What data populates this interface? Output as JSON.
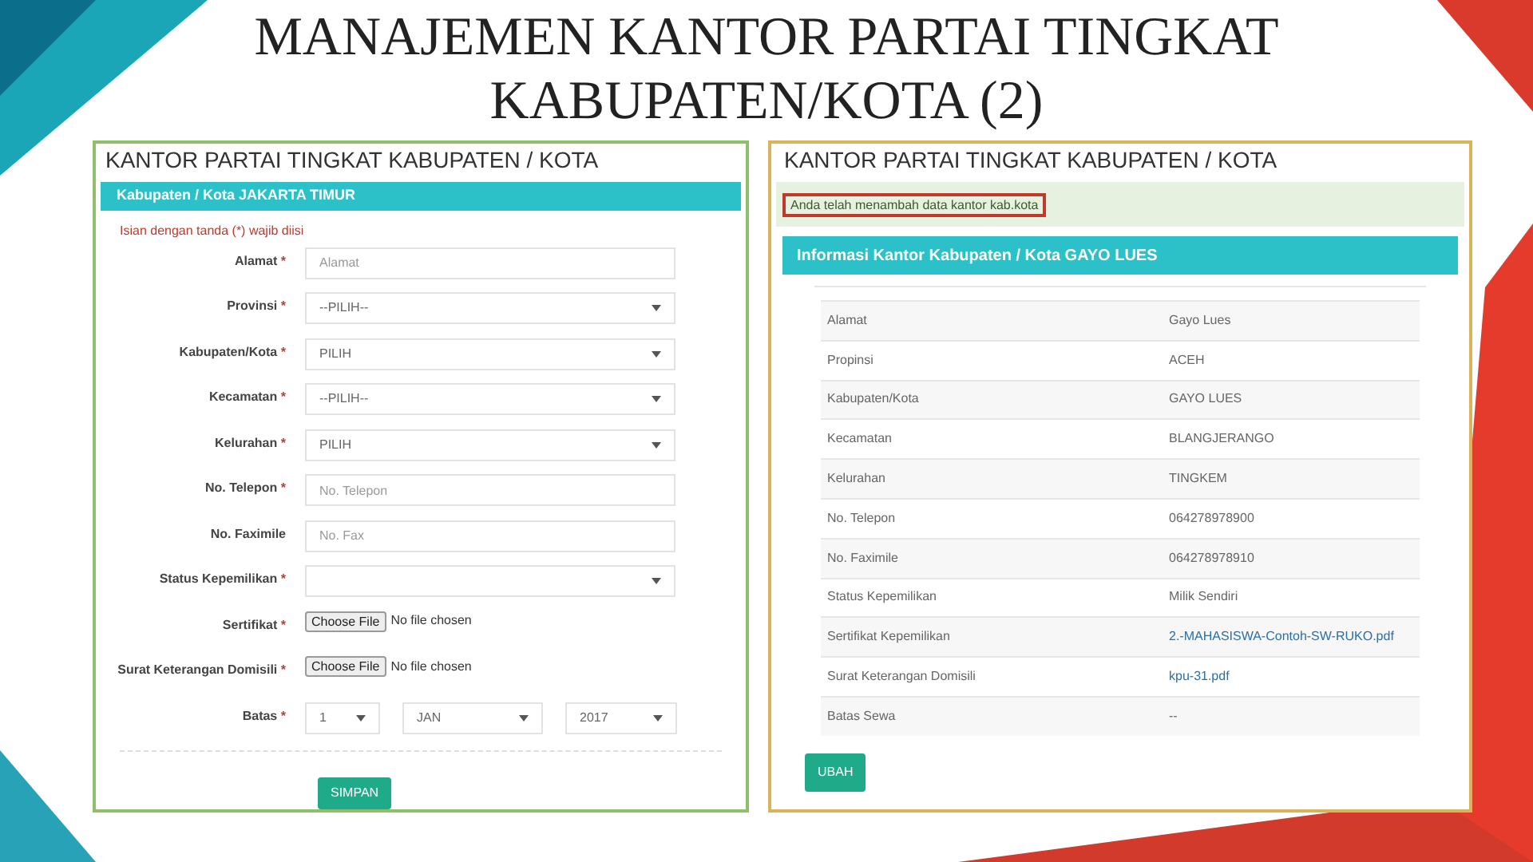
{
  "slide_title": "MANAJEMEN KANTOR PARTAI TINGKAT KABUPATEN/KOTA (2)",
  "form_panel": {
    "title": "KANTOR PARTAI TINGKAT KABUPATEN / KOTA",
    "header": "Kabupaten / Kota JAKARTA TIMUR",
    "note": "Isian dengan tanda (*) wajib diisi",
    "fields": [
      {
        "label": "Alamat",
        "mark": "*",
        "kind": "input",
        "placeholder": "Alamat"
      },
      {
        "label": "Provinsi",
        "mark": "*",
        "kind": "select",
        "value": "--PILIH--"
      },
      {
        "label": "Kabupaten/Kota",
        "mark": "*",
        "kind": "select",
        "value": "PILIH"
      },
      {
        "label": "Kecamatan",
        "mark": "*",
        "kind": "select",
        "value": "--PILIH--"
      },
      {
        "label": "Kelurahan",
        "mark": "*",
        "kind": "select",
        "value": "PILIH"
      },
      {
        "label": "No. Telepon",
        "mark": "*",
        "kind": "input",
        "placeholder": "No. Telepon"
      },
      {
        "label": "No. Faximile",
        "kind": "input",
        "placeholder": "No. Fax"
      },
      {
        "label": "Status Kepemilikan",
        "mark": "*",
        "kind": "select"
      },
      {
        "label": "Sertifikat",
        "mark": "*",
        "kind": "file",
        "button": "Choose File",
        "status": "No file chosen"
      },
      {
        "label": "Surat Keterangan Domisili",
        "mark": "*",
        "kind": "file",
        "button": "Choose File",
        "status": "No file chosen"
      },
      {
        "label": "Batas",
        "mark": "*",
        "kind": "date",
        "parts": [
          "1",
          "JAN",
          "2017"
        ]
      }
    ],
    "submit": "SIMPAN"
  },
  "info_panel": {
    "title": "KANTOR PARTAI TINGKAT KABUPATEN / KOTA",
    "alert": "Anda telah menambah data kantor kab.kota",
    "header": "Informasi Kantor Kabupaten / Kota GAYO LUES",
    "rows": [
      {
        "label": "Alamat",
        "value": "Gayo Lues",
        "link": false
      },
      {
        "label": "Propinsi",
        "value": "ACEH",
        "link": false
      },
      {
        "label": "Kabupaten/Kota",
        "value": "GAYO LUES",
        "link": false
      },
      {
        "label": "Kecamatan",
        "value": "BLANGJERANGO",
        "link": false
      },
      {
        "label": "Kelurahan",
        "value": "TINGKEM",
        "link": false
      },
      {
        "label": "No. Telepon",
        "value": "064278978900",
        "link": false
      },
      {
        "label": "No. Faximile",
        "value": "064278978910",
        "link": false
      },
      {
        "label": "Status Kepemilikan",
        "value": "Milik Sendiri",
        "link": false
      },
      {
        "label": "Sertifikat Kepemilikan",
        "value": "2.-MAHASISWA-Contoh-SW-RUKO.pdf",
        "link": true
      },
      {
        "label": "Surat Keterangan Domisili",
        "value": "kpu-31.pdf",
        "link": true
      },
      {
        "label": "Batas Sewa",
        "value": "--",
        "link": false
      }
    ],
    "edit": "UBAH"
  }
}
